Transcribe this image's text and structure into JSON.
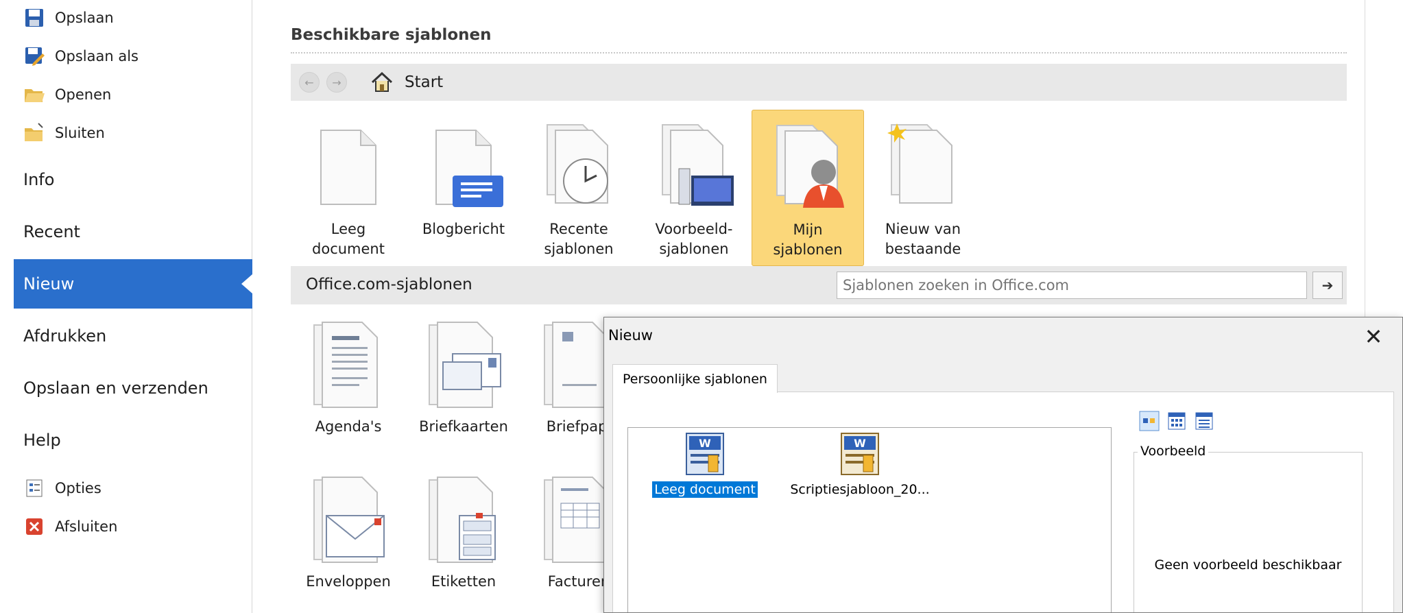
{
  "nav": {
    "commands": [
      {
        "label": "Opslaan",
        "icon": "save-icon"
      },
      {
        "label": "Opslaan als",
        "icon": "save-as-icon"
      },
      {
        "label": "Openen",
        "icon": "open-folder-icon"
      },
      {
        "label": "Sluiten",
        "icon": "close-folder-icon"
      }
    ],
    "tabs": [
      {
        "label": "Info"
      },
      {
        "label": "Recent"
      },
      {
        "label": "Nieuw",
        "active": true
      },
      {
        "label": "Afdrukken"
      },
      {
        "label": "Opslaan en verzenden"
      },
      {
        "label": "Help"
      }
    ],
    "bottom_commands": [
      {
        "label": "Opties",
        "icon": "options-icon"
      },
      {
        "label": "Afsluiten",
        "icon": "exit-icon"
      }
    ]
  },
  "main": {
    "section_title": "Beschikbare sjablonen",
    "navbar": {
      "home_label": "Start"
    },
    "templates": [
      {
        "label": "Leeg\ndocument",
        "icon": "blank-document-icon"
      },
      {
        "label": "Blogbericht",
        "icon": "blog-post-icon"
      },
      {
        "label": "Recente\nsjablonen",
        "icon": "recent-templates-icon"
      },
      {
        "label": "Voorbeeld-\nsjablonen",
        "icon": "sample-templates-icon"
      },
      {
        "label": "Mijn\nsjablonen",
        "icon": "my-templates-icon",
        "selected": true
      },
      {
        "label": "Nieuw van\nbestaande",
        "icon": "new-from-existing-icon"
      }
    ],
    "office_section": {
      "title": "Office.com-sjablonen",
      "search_placeholder": "Sjablonen zoeken in Office.com"
    },
    "office_templates": [
      {
        "label": "Agenda's",
        "icon": "agenda-icon"
      },
      {
        "label": "Briefkaarten",
        "icon": "postcard-icon"
      },
      {
        "label": "Briefpapi",
        "icon": "letterhead-icon"
      },
      {
        "label": "Enveloppen",
        "icon": "envelope-icon"
      },
      {
        "label": "Etiketten",
        "icon": "labels-icon"
      },
      {
        "label": "Facturen",
        "icon": "invoice-icon"
      }
    ]
  },
  "dialog": {
    "title": "Nieuw",
    "close_glyph": "✕",
    "tab_label": "Persoonlijke sjablonen",
    "files": [
      {
        "name": "Leeg document",
        "selected": true
      },
      {
        "name": "Scriptiesjabloon_20..."
      }
    ],
    "preview_label": "Voorbeeld",
    "preview_text": "Geen voorbeeld beschikbaar"
  },
  "colors": {
    "nav_active": "#2a6fcc",
    "tile_selected": "#fbd77a",
    "file_selected": "#0078d7"
  }
}
